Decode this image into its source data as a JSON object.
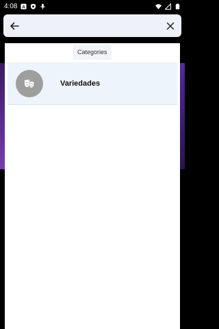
{
  "status_bar": {
    "time": "4:08"
  },
  "search": {
    "placeholder": "",
    "value": ""
  },
  "results": {
    "section_label": "Categories",
    "items": [
      {
        "label": "Variedades",
        "icon": "theater-masks-icon"
      }
    ]
  },
  "colors": {
    "search_bg": "#eef2f8",
    "row_bg": "#eef4fb",
    "avatar_bg": "#9e9e9e"
  }
}
